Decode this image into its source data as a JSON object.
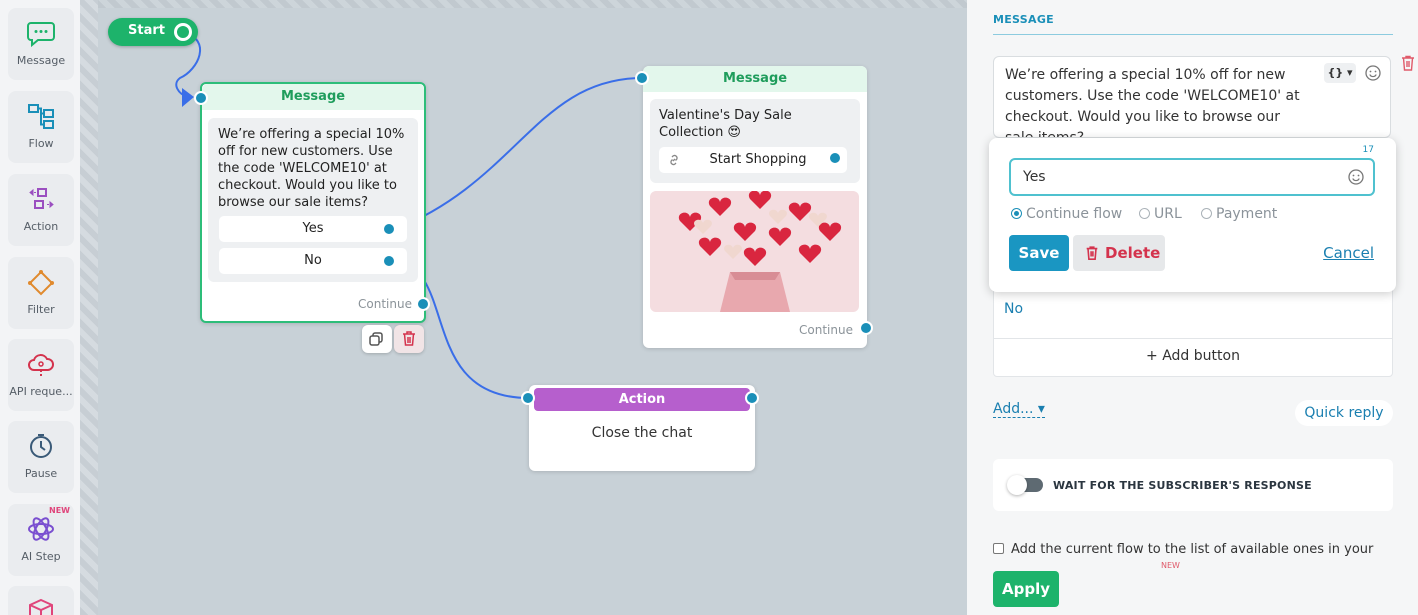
{
  "sidebar": {
    "items": [
      {
        "label": "Message",
        "icon": "chat-bubble-icon"
      },
      {
        "label": "Flow",
        "icon": "flow-icon"
      },
      {
        "label": "Action",
        "icon": "action-icon"
      },
      {
        "label": "Filter",
        "icon": "filter-icon"
      },
      {
        "label": "API reque...",
        "icon": "cloud-api-icon"
      },
      {
        "label": "Pause",
        "icon": "clock-icon"
      },
      {
        "label": "AI Step",
        "icon": "ai-atom-icon",
        "badge": "NEW"
      },
      {
        "label": "",
        "icon": "box-icon"
      }
    ]
  },
  "canvas": {
    "start_label": "Start",
    "message_node_1": {
      "title": "Message",
      "text": "We’re offering a special 10% off for new customers. Use the code 'WELCOME10' at checkout. Would you like to browse our sale items?",
      "buttons": [
        "Yes",
        "No"
      ],
      "continue_label": "Continue"
    },
    "message_node_2": {
      "title": "Message",
      "text": "Valentine's Day Sale Collection 😍",
      "button": "Start Shopping",
      "continue_label": "Continue"
    },
    "action_node": {
      "title": "Action",
      "text": "Close the chat"
    }
  },
  "panel": {
    "section_title": "MESSAGE",
    "message_text": "We’re offering a special 10% off for new customers. Use the code 'WELCOME10' at checkout. Would you like to browse our sale items?",
    "variable_button": "{} ▾",
    "popup": {
      "char_count": "17",
      "input_value": "Yes",
      "radios": [
        "Continue flow",
        "URL",
        "Payment"
      ],
      "save_label": "Save",
      "delete_label": "Delete",
      "cancel_label": "Cancel"
    },
    "button_list_item": "No",
    "add_button_label": "+ Add button",
    "add_label": "Add... ▾",
    "quick_reply_label": "Quick reply",
    "wait_label": "WAIT FOR THE SUBSCRIBER'S RESPONSE",
    "checkbox_label": "Add the current flow to the list of available ones in your",
    "checkbox_badge": "NEW",
    "apply_label": "Apply"
  },
  "colors": {
    "green": "#1db36b",
    "blue": "#1a8fb8",
    "purple": "#b65fcd",
    "red": "#d4334d",
    "wire": "#3a6ee8"
  }
}
